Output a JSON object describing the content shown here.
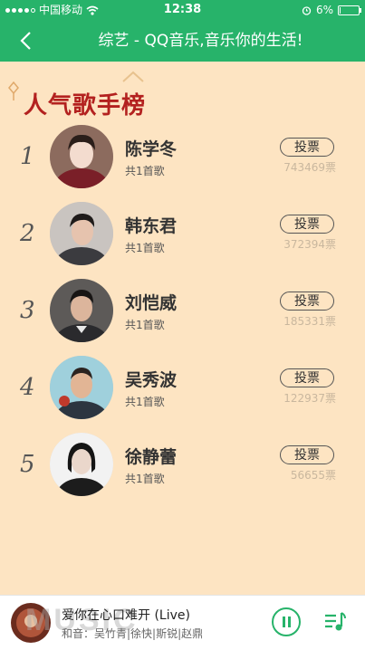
{
  "status_bar": {
    "carrier": "中国移动",
    "time": "12:38",
    "battery": "6%",
    "battery_level": 0.06
  },
  "header": {
    "title": "综艺 - QQ音乐,音乐你的生活!"
  },
  "ranking": {
    "title": "人气歌手榜",
    "vote_label": "投票",
    "items": [
      {
        "rank": "1",
        "name": "陈学冬",
        "songs": "共1首歌",
        "votes": "743469票"
      },
      {
        "rank": "2",
        "name": "韩东君",
        "songs": "共1首歌",
        "votes": "372394票"
      },
      {
        "rank": "3",
        "name": "刘恺威",
        "songs": "共1首歌",
        "votes": "185331票"
      },
      {
        "rank": "4",
        "name": "吴秀波",
        "songs": "共1首歌",
        "votes": "122937票"
      },
      {
        "rank": "5",
        "name": "徐静蕾",
        "songs": "共1首歌",
        "votes": "56655票"
      }
    ]
  },
  "player": {
    "song_title": "爱你在心口难开 (Live)",
    "artist": "和音：吴竹青|徐快|斯锐|赵鼎",
    "watermark": "MUSIC"
  },
  "colors": {
    "brand_green": "#27b36a",
    "background": "#fde4c2",
    "title_red": "#b3211f"
  },
  "icons": {
    "back": "chevron-left-icon",
    "wifi": "wifi-icon",
    "alarm": "alarm-icon",
    "pause": "pause-icon",
    "playlist": "playlist-icon"
  }
}
